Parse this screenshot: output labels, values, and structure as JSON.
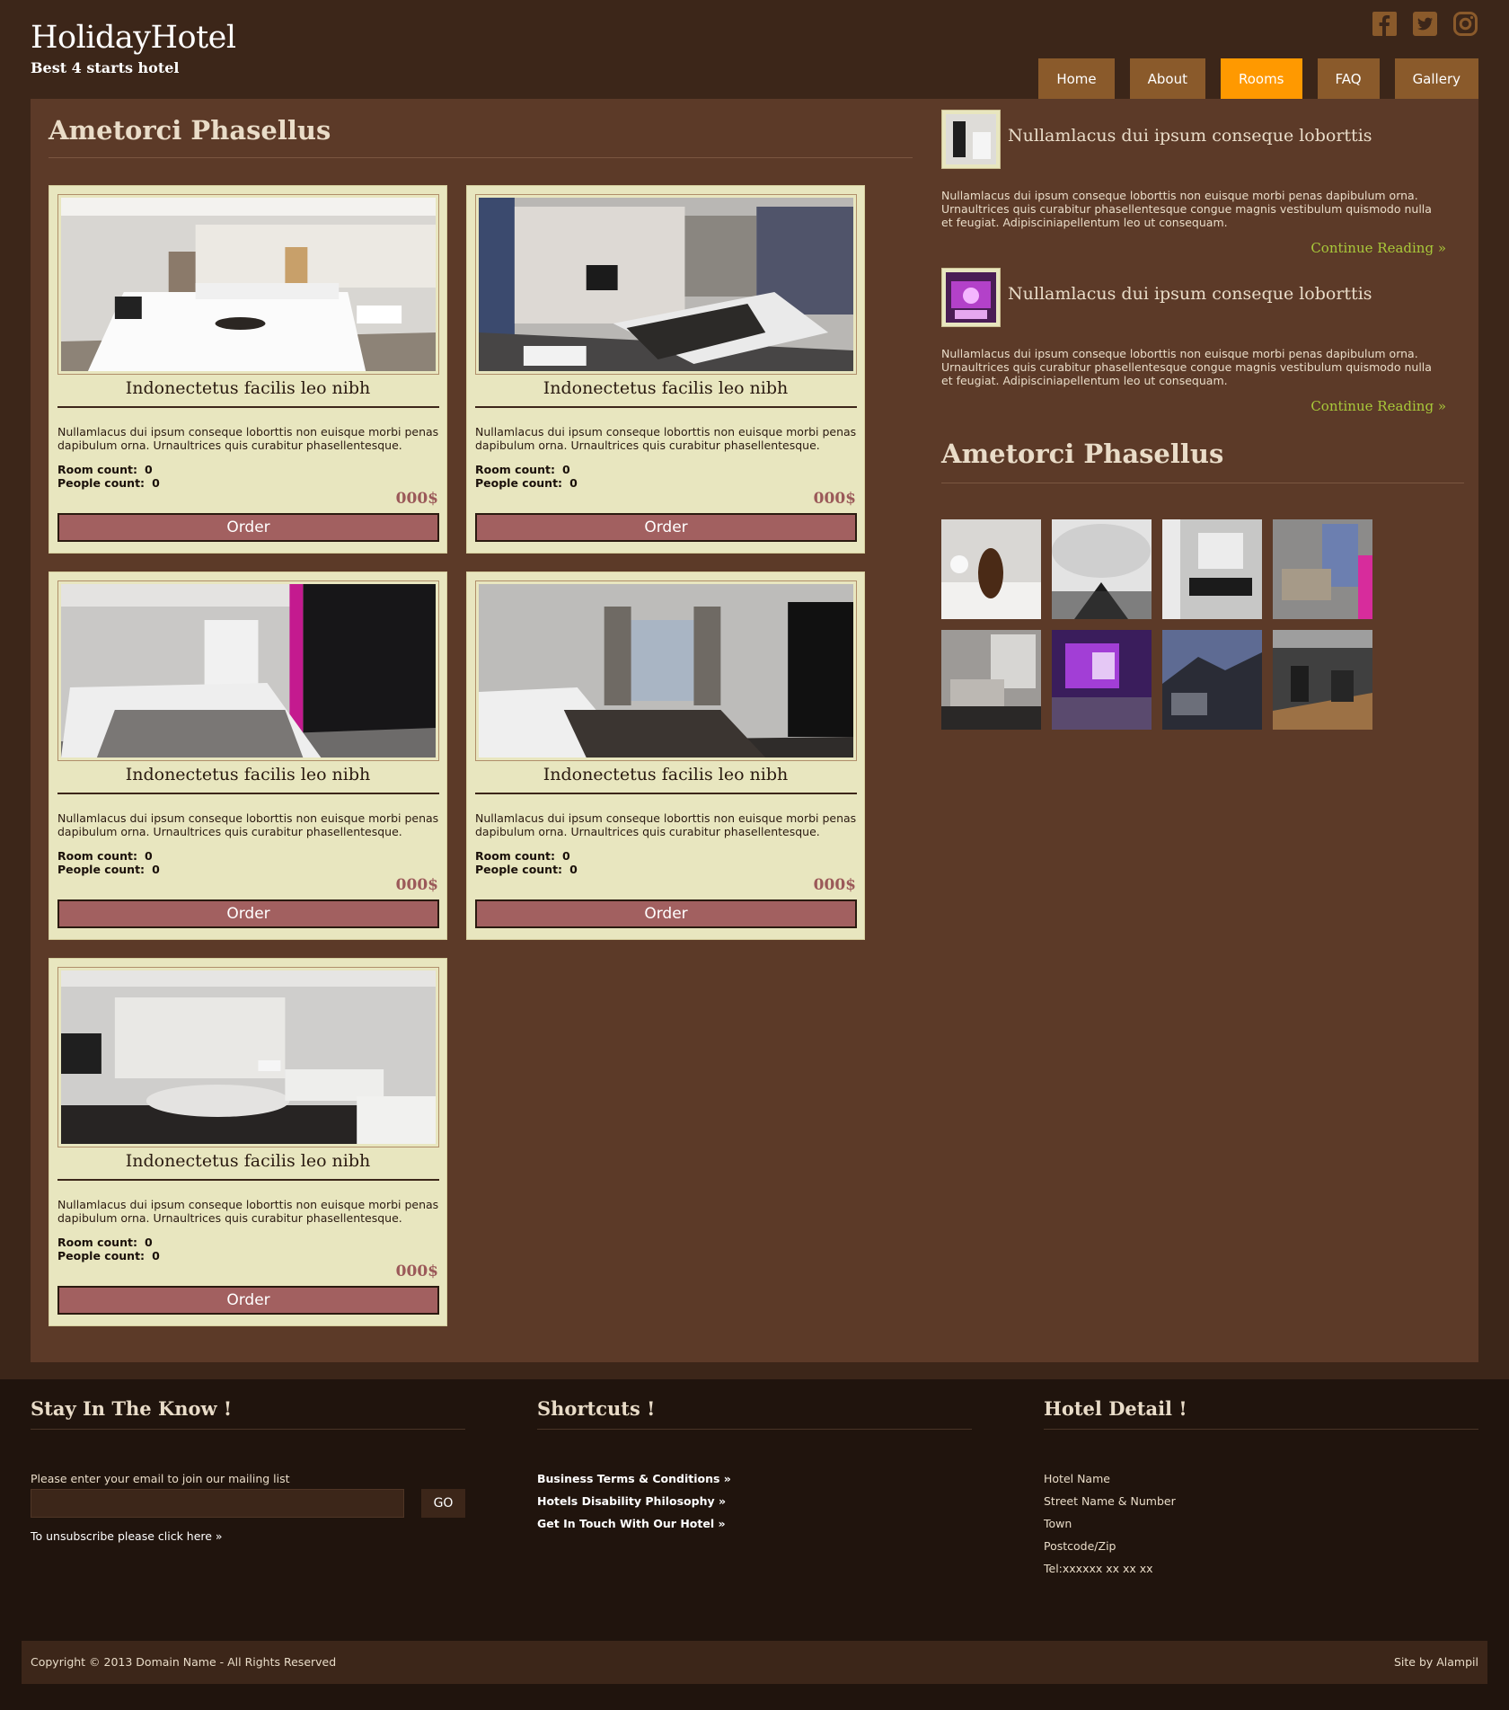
{
  "header": {
    "title": "HolidayHotel",
    "tagline": "Best 4 starts hotel",
    "social": [
      "facebook-icon",
      "twitter-icon",
      "instagram-icon"
    ],
    "nav": [
      {
        "label": "Home",
        "active": false
      },
      {
        "label": "About",
        "active": false
      },
      {
        "label": "Rooms",
        "active": true
      },
      {
        "label": "FAQ",
        "active": false
      },
      {
        "label": "Gallery",
        "active": false
      }
    ]
  },
  "colors": {
    "page_bg": "#3c2619",
    "panel_bg": "#5c3a28",
    "card_bg": "#e8e6bf",
    "nav_bg": "#8a5a2b",
    "nav_active": "#ff9900",
    "order_button": "#a26060",
    "price": "#9b5959",
    "link_green": "#a8c83a"
  },
  "content": {
    "title": "Ametorci Phasellus",
    "rooms": [
      {
        "title": "Indonectetus facilis leo nibh",
        "desc": "Nullamlacus dui ipsum conseque loborttis non euisque morbi penas dapibulum orna. Urnaultrices quis curabitur phasellentesque.",
        "room_label": "Room count:",
        "room_value": "0",
        "people_label": "People count:",
        "people_value": "0",
        "price": "000$",
        "order": "Order"
      },
      {
        "title": "Indonectetus facilis leo nibh",
        "desc": "Nullamlacus dui ipsum conseque loborttis non euisque morbi penas dapibulum orna. Urnaultrices quis curabitur phasellentesque.",
        "room_label": "Room count:",
        "room_value": "0",
        "people_label": "People count:",
        "people_value": "0",
        "price": "000$",
        "order": "Order"
      },
      {
        "title": "Indonectetus facilis leo nibh",
        "desc": "Nullamlacus dui ipsum conseque loborttis non euisque morbi penas dapibulum orna. Urnaultrices quis curabitur phasellentesque.",
        "room_label": "Room count:",
        "room_value": "0",
        "people_label": "People count:",
        "people_value": "0",
        "price": "000$",
        "order": "Order"
      },
      {
        "title": "Indonectetus facilis leo nibh",
        "desc": "Nullamlacus dui ipsum conseque loborttis non euisque morbi penas dapibulum orna. Urnaultrices quis curabitur phasellentesque.",
        "room_label": "Room count:",
        "room_value": "0",
        "people_label": "People count:",
        "people_value": "0",
        "price": "000$",
        "order": "Order"
      },
      {
        "title": "Indonectetus facilis leo nibh",
        "desc": "Nullamlacus dui ipsum conseque loborttis non euisque morbi penas dapibulum orna. Urnaultrices quis curabitur phasellentesque.",
        "room_label": "Room count:",
        "room_value": "0",
        "people_label": "People count:",
        "people_value": "0",
        "price": "000$",
        "order": "Order"
      }
    ]
  },
  "sidebar": {
    "posts": [
      {
        "title": "Nullamlacus dui ipsum conseque loborttis",
        "text": "Nullamlacus dui ipsum conseque loborttis non euisque morbi penas dapibulum orna. Urnaultrices quis curabitur phasellentesque congue magnis vestibulum quismodo nulla et feugiat. Adipisciniapellentum leo ut consequam.",
        "more": "Continue Reading »"
      },
      {
        "title": "Nullamlacus dui ipsum conseque loborttis",
        "text": "Nullamlacus dui ipsum conseque loborttis non euisque morbi penas dapibulum orna. Urnaultrices quis curabitur phasellentesque congue magnis vestibulum quismodo nulla et feugiat. Adipisciniapellentum leo ut consequam.",
        "more": "Continue Reading »"
      }
    ],
    "gallery_title": "Ametorci Phasellus"
  },
  "footer": {
    "newsletter": {
      "heading": "Stay In The Know !",
      "label": "Please enter your email to join our mailing list",
      "input_value": "",
      "button": "GO",
      "unsubscribe": "To unsubscribe please click here »"
    },
    "shortcuts": {
      "heading": "Shortcuts !",
      "links": [
        "Business Terms & Conditions »",
        "Hotels Disability Philosophy »",
        "Get In Touch With Our Hotel »"
      ]
    },
    "hotel": {
      "heading": "Hotel Detail !",
      "lines": [
        "Hotel Name",
        "Street Name & Number",
        "Town",
        "Postcode/Zip",
        "Tel:xxxxxx xx xx xx"
      ]
    },
    "copyright": "Copyright © 2013 Domain Name - All Rights Reserved",
    "credit": "Site by Alampil"
  }
}
